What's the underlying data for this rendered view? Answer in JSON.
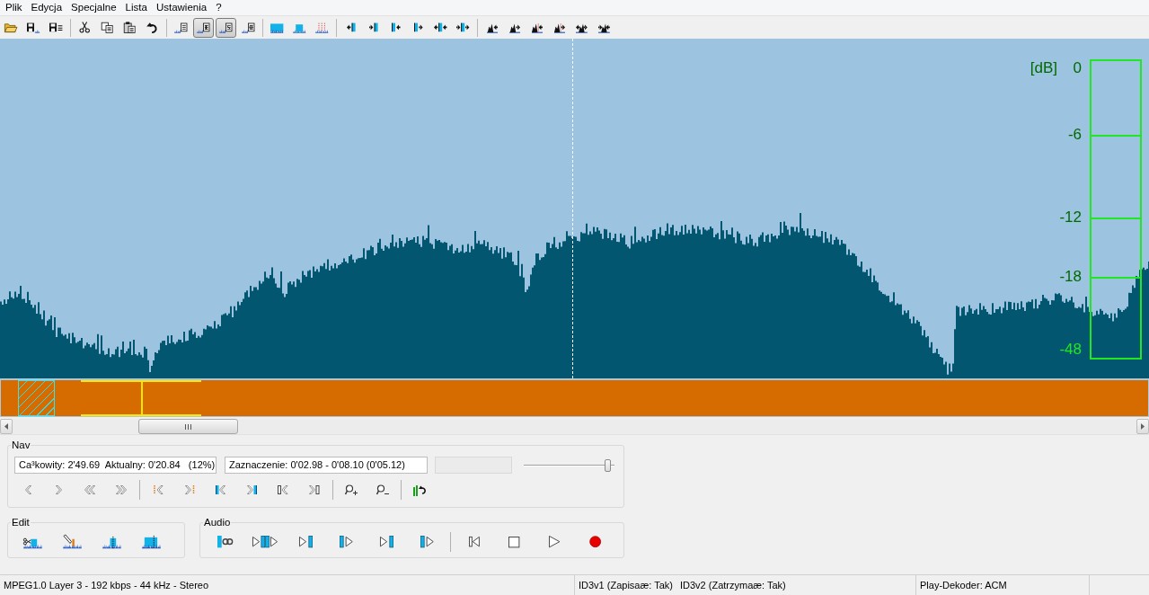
{
  "menu": [
    "Plik",
    "Edycja",
    "Specjalne",
    "Lista",
    "Ustawienia",
    "?"
  ],
  "toolbar": {
    "groups": [
      [
        {
          "pressed": false
        },
        {
          "pressed": false
        },
        {
          "pressed": false
        }
      ],
      [
        {
          "pressed": false
        },
        {
          "pressed": false
        },
        {
          "pressed": false
        },
        {
          "pressed": false
        }
      ],
      [
        {
          "pressed": false
        },
        {
          "pressed": true
        },
        {
          "pressed": true
        },
        {
          "pressed": false
        }
      ],
      [
        {
          "pressed": false
        },
        {
          "pressed": false
        },
        {
          "pressed": false
        }
      ],
      [
        {
          "pressed": false
        },
        {
          "pressed": false
        },
        {
          "pressed": false
        },
        {
          "pressed": false
        },
        {
          "pressed": false
        },
        {
          "pressed": false
        }
      ],
      [
        {
          "pressed": false
        },
        {
          "pressed": false
        },
        {
          "pressed": false
        },
        {
          "pressed": false
        },
        {
          "pressed": false
        },
        {
          "pressed": false
        }
      ]
    ]
  },
  "waveform": {
    "db_scale": {
      "unit": "[dB]",
      "labels": [
        "0",
        "-6",
        "-12",
        "-18",
        "-48"
      ]
    }
  },
  "timeline": {
    "playhead": {
      "level": 0.123
    }
  },
  "nav": {
    "title": "Nav",
    "fields": [
      {
        "value": "Ca³kowity: 2'49.69  Aktualny: 0'20.84   (12%)",
        "disabled": false
      },
      {
        "value": "Zaznaczenie: 0'02.98 - 0'08.10 (0'05.12)",
        "disabled": false
      },
      {
        "disabled": true
      }
    ],
    "slider": {
      "level": 0.96
    }
  },
  "edit": {
    "title": "Edit"
  },
  "audio": {
    "title": "Audio"
  },
  "status_bar": {
    "panels": [
      {
        "texts": [
          "MPEG1.0 Layer 3 - 192 kbps - 44 kHz - Stereo"
        ]
      },
      {
        "texts": [
          "ID3v1 (Zapisaæ: Tak)",
          "ID3v2 (Zatrzymaæ: Tak)"
        ]
      },
      {
        "texts": [
          "Play-Dekoder: ACM"
        ]
      }
    ]
  }
}
